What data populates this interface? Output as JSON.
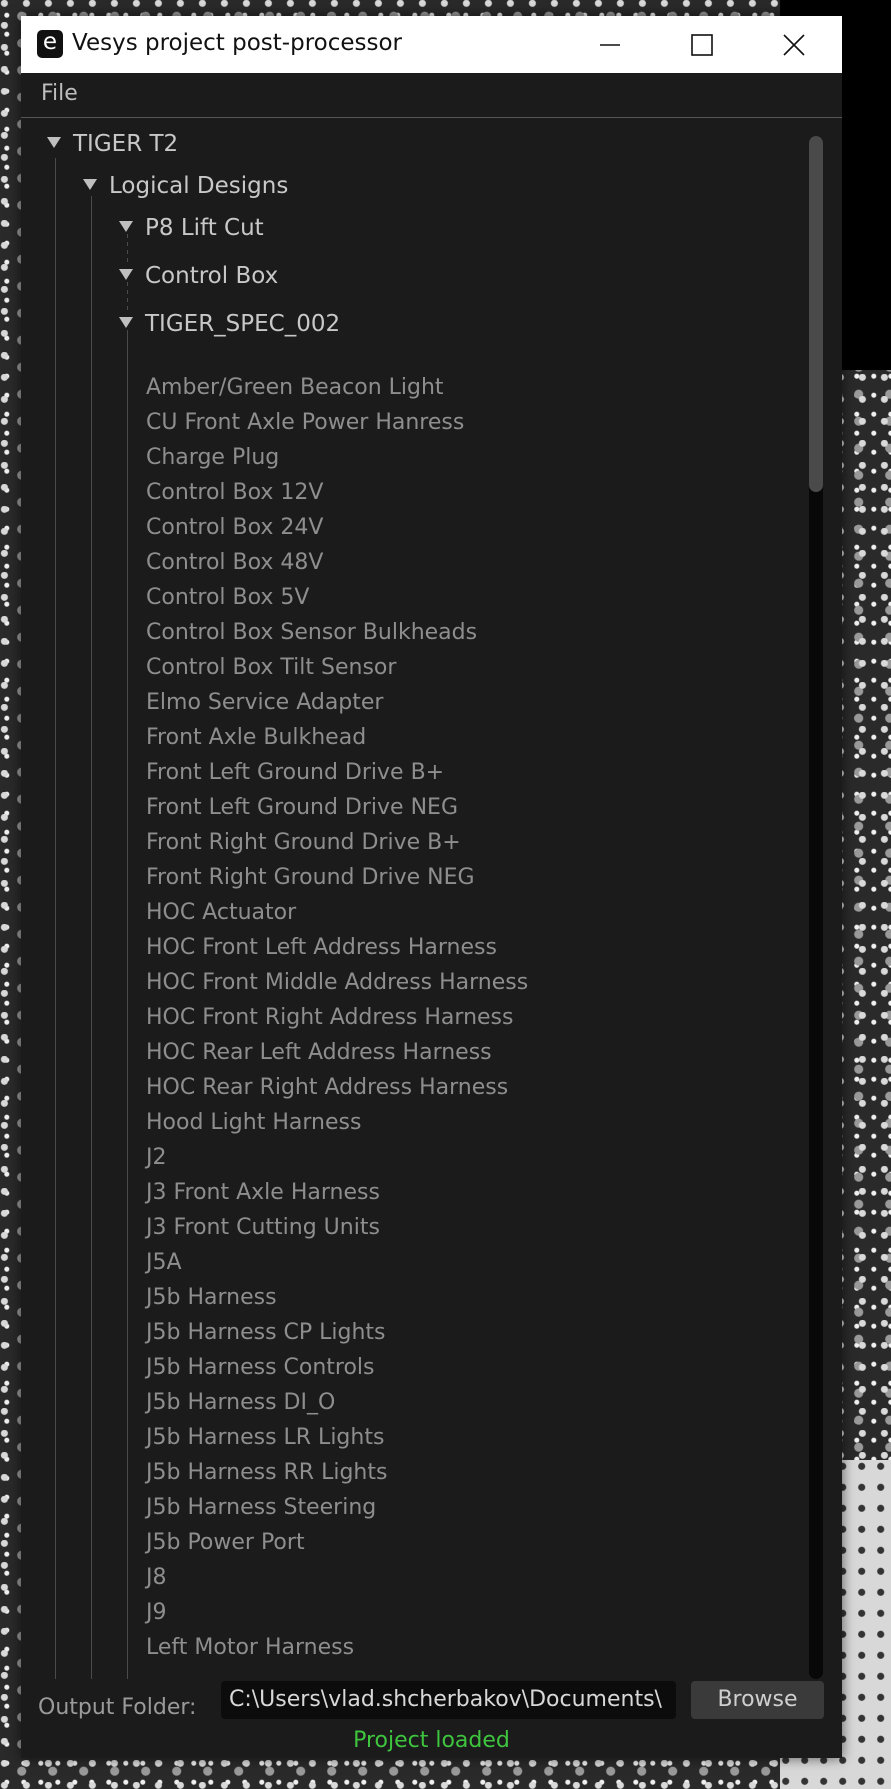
{
  "window": {
    "title": "Vesys project post-processor",
    "icon_letter": "e"
  },
  "menu": {
    "file": "File"
  },
  "tree": {
    "root": "TIGER T2",
    "group": "Logical Designs",
    "designs": [
      "P8 Lift Cut",
      "Control Box",
      "TIGER_SPEC_002"
    ],
    "items": [
      "Amber/Green Beacon Light",
      "CU Front Axle Power Hanress",
      "Charge Plug",
      "Control Box 12V",
      "Control Box 24V",
      "Control Box 48V",
      "Control Box 5V",
      "Control Box Sensor Bulkheads",
      "Control Box Tilt Sensor",
      "Elmo Service Adapter",
      "Front Axle Bulkhead",
      "Front Left Ground Drive B+",
      "Front Left Ground Drive NEG",
      "Front Right Ground Drive B+",
      "Front Right Ground Drive NEG",
      "HOC Actuator",
      "HOC Front Left Address Harness",
      "HOC Front Middle Address Harness",
      "HOC Front Right Address Harness",
      "HOC Rear Left Address Harness",
      "HOC Rear Right Address Harness",
      "Hood Light Harness",
      "J2",
      "J3 Front Axle Harness",
      "J3 Front Cutting Units",
      "J5A",
      "J5b Harness",
      "J5b Harness CP Lights",
      "J5b Harness Controls",
      "J5b Harness DI_O",
      "J5b Harness LR Lights",
      "J5b Harness RR Lights",
      "J5b Harness Steering",
      "J5b Power Port",
      "J8",
      "J9",
      "Left Motor Harness"
    ]
  },
  "output": {
    "label": "Output Folder:",
    "value": "C:\\Users\\vlad.shcherbakov\\Documents\\",
    "browse": "Browse"
  },
  "status": {
    "text": "Project loaded",
    "color": "#3ec43e"
  },
  "scroll": {
    "position_fraction": 0.0,
    "visible_fraction": 0.23
  }
}
